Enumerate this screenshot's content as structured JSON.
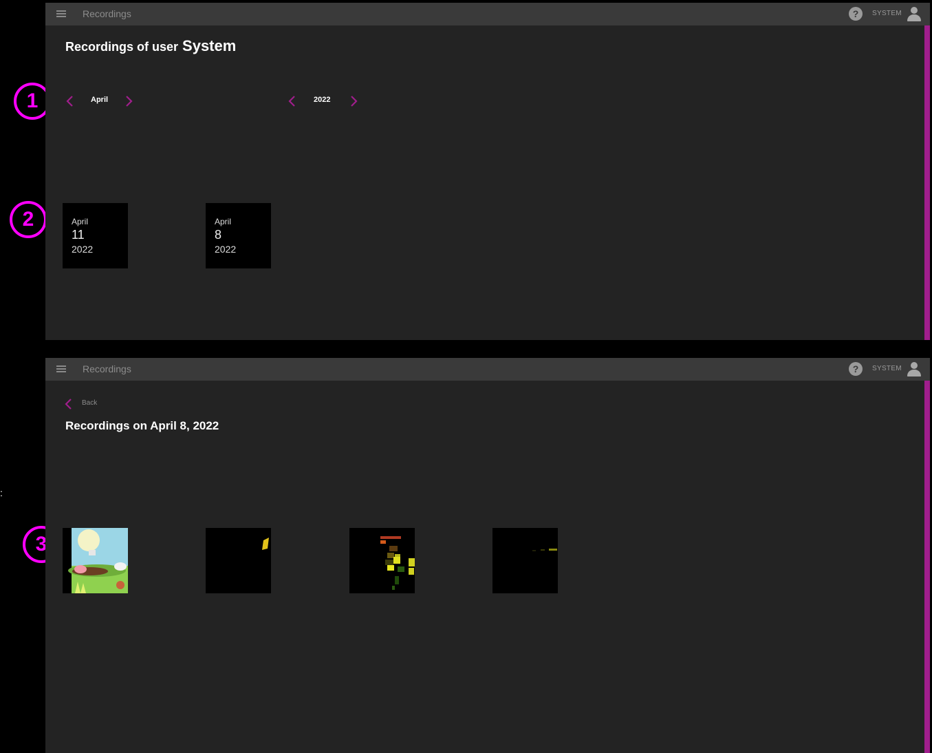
{
  "colors": {
    "accent": "#a01e8c",
    "badge": "#ff00ff",
    "panel": "#232323",
    "appbar": "#3a3a3a",
    "tile": "#000000"
  },
  "appbar": {
    "title": "Recordings",
    "user": "SYSTEM",
    "help_icon": "question-circle-icon",
    "menu_icon": "hamburger-menu-icon",
    "user_icon": "person-icon"
  },
  "overview": {
    "heading_prefix": "Recordings of user",
    "heading_user": "System",
    "month_label": "April",
    "year_label": "2022",
    "days": [
      {
        "month": "April",
        "day": "11",
        "year": "2022"
      },
      {
        "month": "April",
        "day": "8",
        "year": "2022"
      }
    ]
  },
  "detail": {
    "back_label": "Back",
    "heading": "Recordings on April 8, 2022",
    "thumbnails": [
      "farm-scene-thumbnail",
      "black-thumbnail-yellow-bird",
      "black-thumbnail-pixel-blocks",
      "black-thumbnail-faint-spark"
    ]
  },
  "badges": [
    "1",
    "2",
    "3"
  ],
  "side_text": ":"
}
